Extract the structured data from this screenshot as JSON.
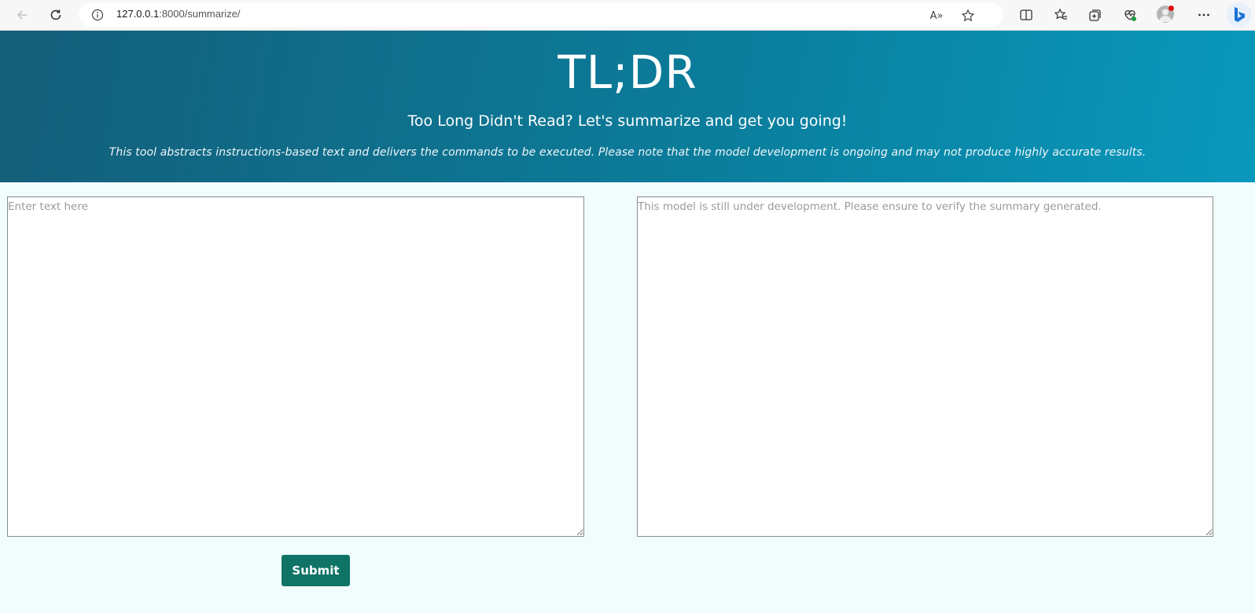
{
  "browser": {
    "url_host": "127.0.0.1",
    "url_path": ":8000/summarize/",
    "read_aloud_label": "A»"
  },
  "header": {
    "title": "TL;DR",
    "subtitle": "Too Long Didn't Read? Let's summarize and get you going!",
    "description": "This tool abstracts instructions-based text and delivers the commands to be executed. Please note that the model development is ongoing and may not produce highly accurate results."
  },
  "form": {
    "input_placeholder": "Enter text here",
    "input_value": "",
    "output_placeholder": "This model is still under development. Please ensure to verify the summary generated.",
    "output_value": "",
    "submit_label": "Submit"
  },
  "colors": {
    "header_gradient_start": "#145e79",
    "header_gradient_end": "#0999bd",
    "submit_button": "#0f7466",
    "page_background": "#f1fdfd"
  }
}
